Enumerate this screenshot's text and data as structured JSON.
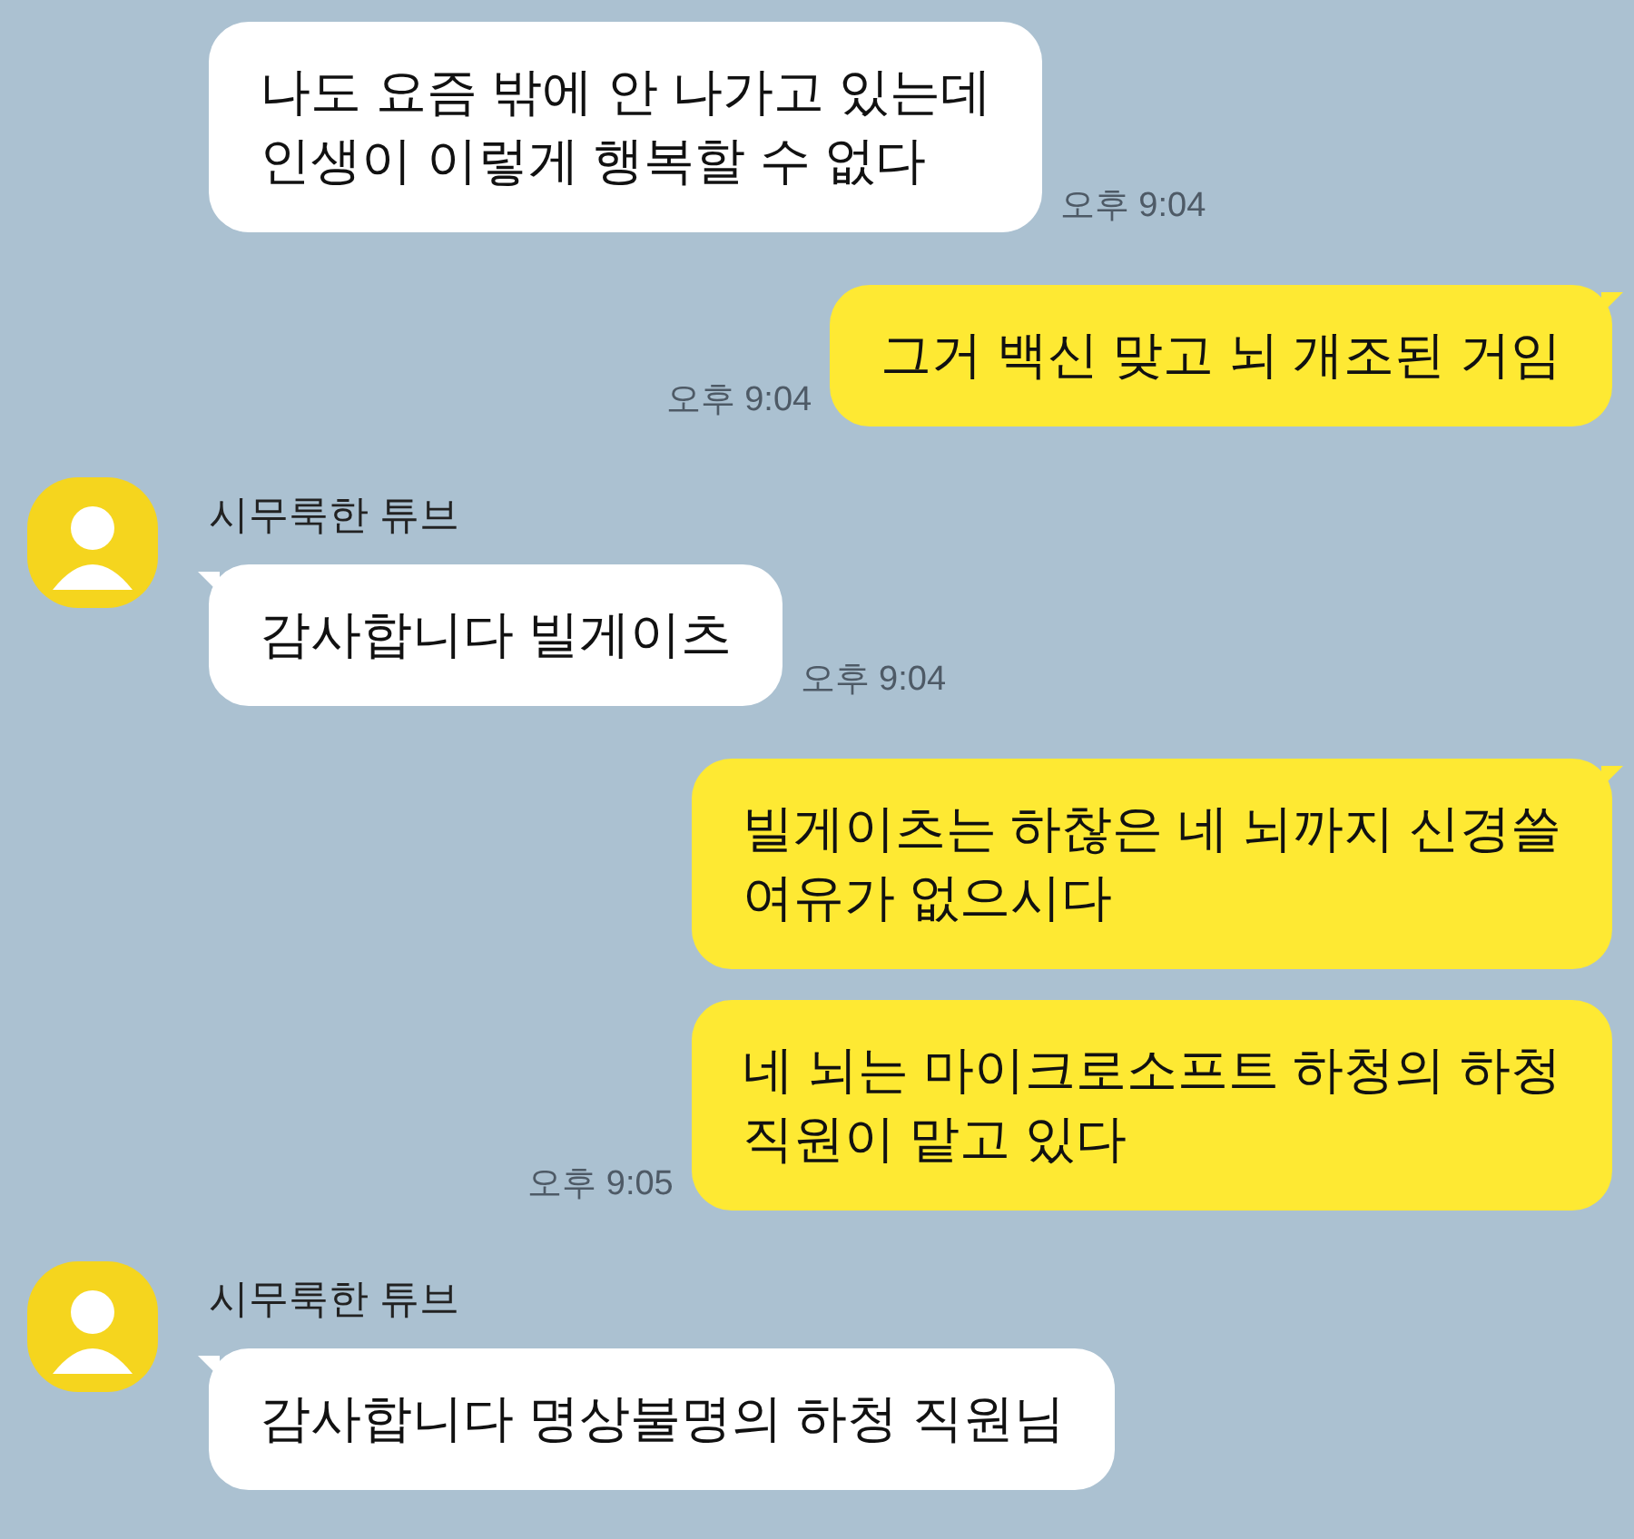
{
  "messages": [
    {
      "kind": "incoming",
      "text": "나도 요즘 밖에 안 나가고 있는데\n인생이 이렇게 행복할 수 없다",
      "time": "오후 9:04",
      "tail": false
    },
    {
      "kind": "outgoing",
      "text": "그거 백신 맞고 뇌 개조된 거임",
      "time": "오후 9:04",
      "tail": true
    },
    {
      "kind": "incoming",
      "sender": "시무룩한 튜브",
      "text": "감사합니다 빌게이츠",
      "time": "오후 9:04",
      "tail": true
    },
    {
      "kind": "outgoing",
      "text": "빌게이츠는 하찮은 네 뇌까지 신경쓸\n여유가 없으시다",
      "tail": true
    },
    {
      "kind": "outgoing",
      "text": "네 뇌는 마이크로소프트 하청의 하청\n직원이 맡고 있다",
      "time": "오후 9:05",
      "tail": false
    },
    {
      "kind": "incoming",
      "sender": "시무룩한 튜브",
      "text": "감사합니다 명상불명의 하청 직원님",
      "tail": true
    }
  ]
}
